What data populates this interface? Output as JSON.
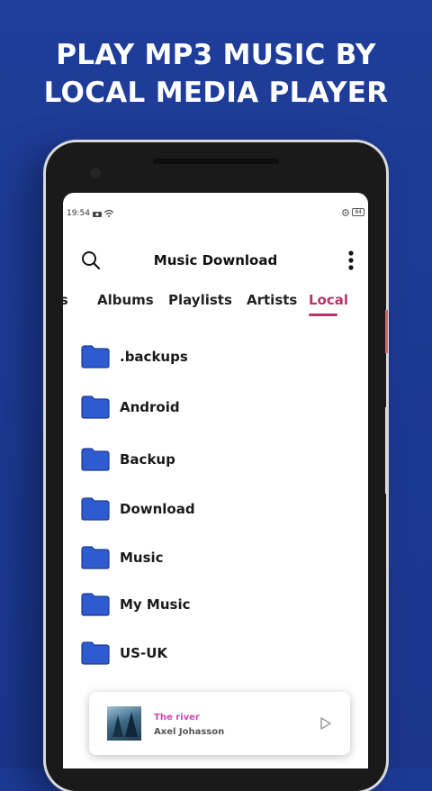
{
  "headline": {
    "line1": "PLAY MP3 MUSIC BY",
    "line2": "LOCAL MEDIA PLAYER"
  },
  "status_bar": {
    "time": "19:54",
    "battery": "84"
  },
  "app_bar": {
    "title": "Music Download",
    "search_icon": "search-icon",
    "menu_icon": "more-vertical-icon"
  },
  "tabs": [
    {
      "label": "gs",
      "active": false
    },
    {
      "label": "Albums",
      "active": false
    },
    {
      "label": "Playlists",
      "active": false
    },
    {
      "label": "Artists",
      "active": false
    },
    {
      "label": "Local",
      "active": true
    }
  ],
  "folders": [
    {
      "name": ".backups"
    },
    {
      "name": "Android"
    },
    {
      "name": "Backup"
    },
    {
      "name": "Download"
    },
    {
      "name": "Music"
    },
    {
      "name": "My Music"
    },
    {
      "name": "US-UK"
    }
  ],
  "now_playing": {
    "title": "The river",
    "artist": "Axel Johasson",
    "play_icon": "play-icon"
  },
  "colors": {
    "background": "#1c3a94",
    "accent": "#b8336a",
    "track_title": "#d248b8",
    "folder": "#2f5bd0"
  }
}
